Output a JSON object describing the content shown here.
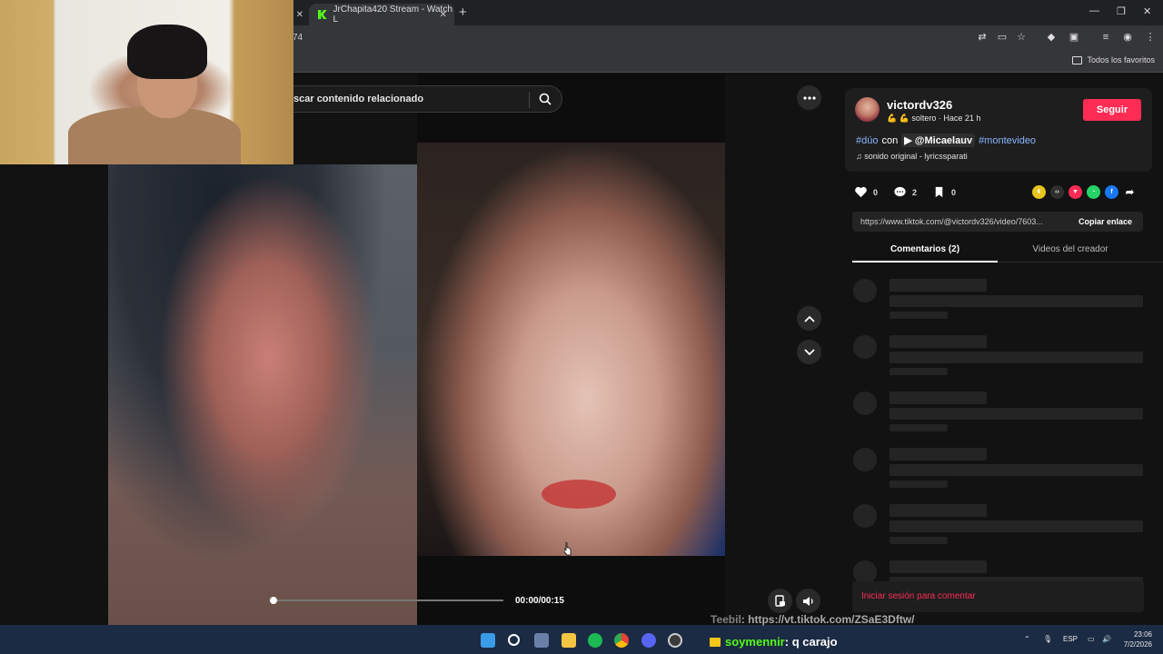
{
  "browser": {
    "tabs": [
      {
        "label": "",
        "close": "✕"
      },
      {
        "label": "JrChapita420 Stream - Watch L",
        "close": "✕"
      }
    ],
    "new_tab": "+",
    "url_fragment": "74",
    "bookmarks_label": "Todos los favoritos",
    "window_controls": [
      "—",
      "❐",
      "✕"
    ]
  },
  "page": {
    "search_placeholder": "scar contenido relacionado",
    "time": "00:00/00:15",
    "progress_fraction": 0.0
  },
  "panel": {
    "username": "victordv326",
    "meta": "💪 💪 soltero · Hace 21 h",
    "follow": "Seguir",
    "tag1": "#dúo",
    "con": "con",
    "mention": "▶ @Micaelauv",
    "tag2": "#montevideo",
    "music": "♫  sonido original - lyricssparati",
    "likes": "0",
    "comments": "2",
    "saves": "0",
    "link": "https://www.tiktok.com/@victordv326/video/7603...",
    "copy_link": "Copiar enlace",
    "tab_comments": "Comentarios (2)",
    "tab_creator": "Videos del creador",
    "login_comment": "Iniciar sesión para comentar"
  },
  "chat": {
    "msg1_user": "Teebil",
    "msg1_text": ": https://vt.tiktok.com/ZSaE3Dftw/",
    "msg2_user": "soymennir",
    "msg2_text": ": q carajo"
  },
  "taskbar": {
    "lang": "ESP",
    "time": "23:06",
    "date": "7/2/2026"
  },
  "colors": {
    "accent": "#fe2c55",
    "kick_green": "#53fc18",
    "taskbar": "#1c2b44"
  }
}
